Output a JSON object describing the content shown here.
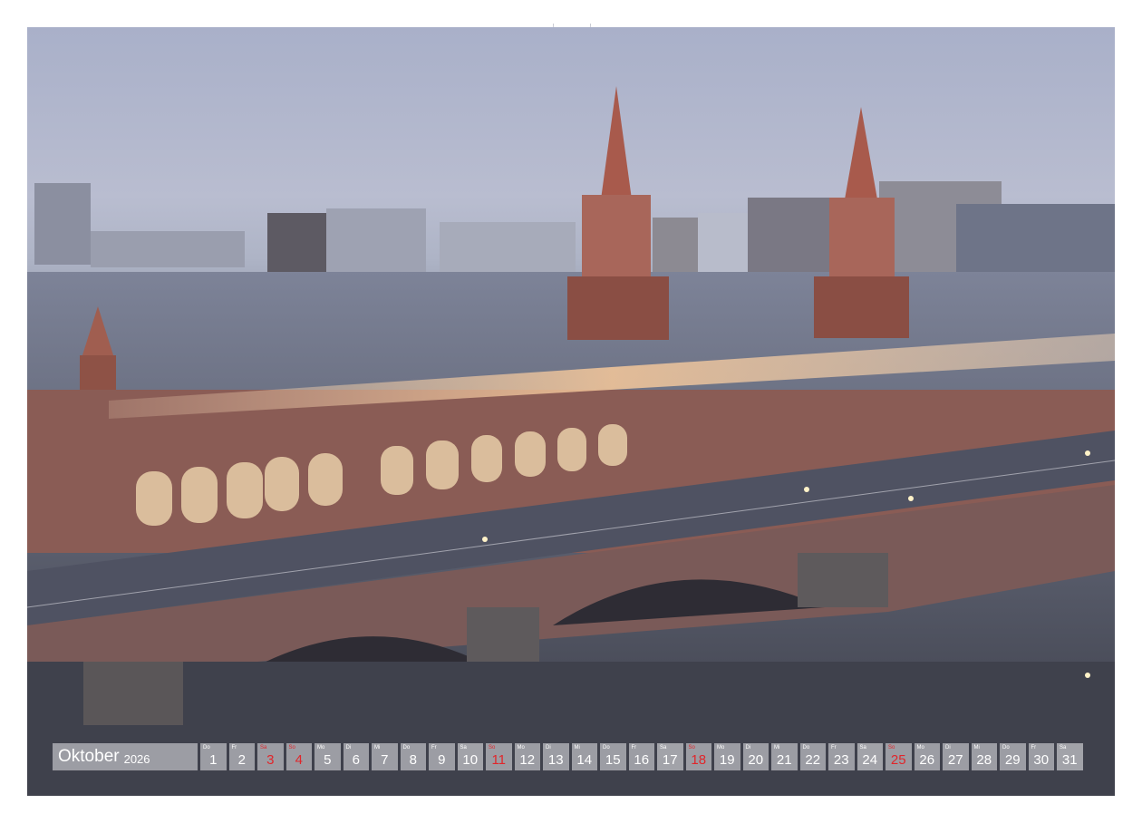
{
  "calendar": {
    "month": "Oktober",
    "year": "2026",
    "colors": {
      "holiday": "#e0262b",
      "bar": "#aaaab0",
      "text": "#ffffff"
    },
    "days": [
      {
        "abbr": "Do",
        "num": "1",
        "type": "normal"
      },
      {
        "abbr": "Fr",
        "num": "2",
        "type": "normal"
      },
      {
        "abbr": "Sa",
        "num": "3",
        "type": "holiday"
      },
      {
        "abbr": "So",
        "num": "4",
        "type": "holiday"
      },
      {
        "abbr": "Mo",
        "num": "5",
        "type": "normal"
      },
      {
        "abbr": "Di",
        "num": "6",
        "type": "normal"
      },
      {
        "abbr": "Mi",
        "num": "7",
        "type": "normal"
      },
      {
        "abbr": "Do",
        "num": "8",
        "type": "normal"
      },
      {
        "abbr": "Fr",
        "num": "9",
        "type": "normal"
      },
      {
        "abbr": "Sa",
        "num": "10",
        "type": "weekend"
      },
      {
        "abbr": "So",
        "num": "11",
        "type": "holiday"
      },
      {
        "abbr": "Mo",
        "num": "12",
        "type": "normal"
      },
      {
        "abbr": "Di",
        "num": "13",
        "type": "normal"
      },
      {
        "abbr": "Mi",
        "num": "14",
        "type": "normal"
      },
      {
        "abbr": "Do",
        "num": "15",
        "type": "normal"
      },
      {
        "abbr": "Fr",
        "num": "16",
        "type": "normal"
      },
      {
        "abbr": "Sa",
        "num": "17",
        "type": "weekend"
      },
      {
        "abbr": "So",
        "num": "18",
        "type": "holiday"
      },
      {
        "abbr": "Mo",
        "num": "19",
        "type": "normal"
      },
      {
        "abbr": "Di",
        "num": "20",
        "type": "normal"
      },
      {
        "abbr": "Mi",
        "num": "21",
        "type": "normal"
      },
      {
        "abbr": "Do",
        "num": "22",
        "type": "normal"
      },
      {
        "abbr": "Fr",
        "num": "23",
        "type": "normal"
      },
      {
        "abbr": "Sa",
        "num": "24",
        "type": "weekend"
      },
      {
        "abbr": "So",
        "num": "25",
        "type": "holiday"
      },
      {
        "abbr": "Mo",
        "num": "26",
        "type": "normal"
      },
      {
        "abbr": "Di",
        "num": "27",
        "type": "normal"
      },
      {
        "abbr": "Mi",
        "num": "28",
        "type": "normal"
      },
      {
        "abbr": "Do",
        "num": "29",
        "type": "normal"
      },
      {
        "abbr": "Fr",
        "num": "30",
        "type": "normal"
      },
      {
        "abbr": "Sa",
        "num": "31",
        "type": "weekend"
      }
    ]
  }
}
